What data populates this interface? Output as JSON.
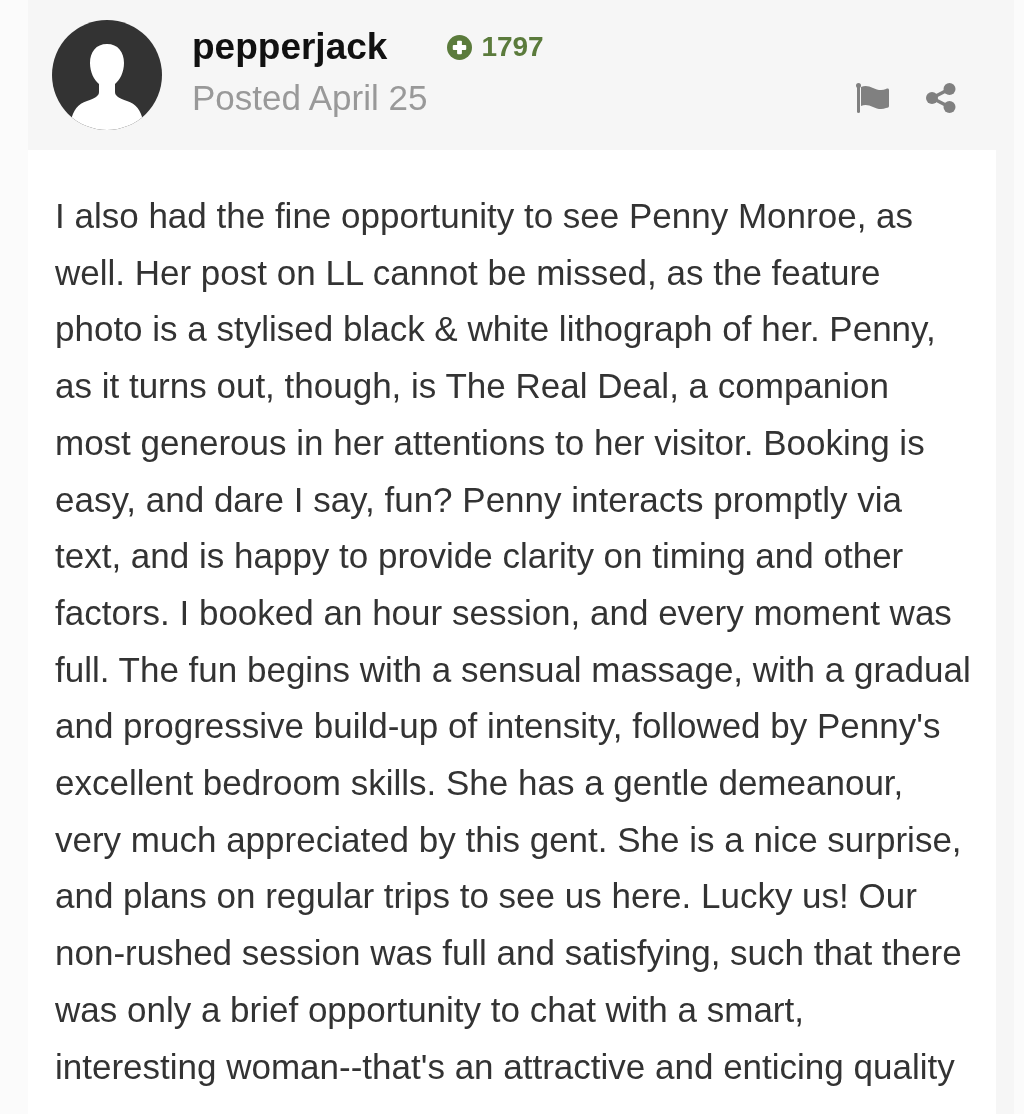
{
  "post": {
    "author": {
      "name": "pepperjack",
      "reputation": "1797"
    },
    "date": "Posted April 25",
    "body": "I also had the fine opportunity to see Penny Monroe, as well. Her post on LL cannot be missed, as the feature photo is a stylised black & white lithograph of her. Penny, as it turns out, though, is The Real Deal, a companion most generous in her attentions to her visitor. Booking is easy, and dare I say, fun? Penny interacts promptly via text, and is happy to provide clarity on timing and other factors. I booked an hour session, and every moment was full. The fun begins with a sensual massage, with a gradual and progressive build-up of intensity, followed by Penny's excellent bedroom skills. She has a gentle demeanour, very much appreciated by this gent. She is a nice surprise, and plans on regular trips to see us here. Lucky us! Our non-rushed session was full and satisfying, such that there was only a brief opportunity to chat with a smart, interesting woman--that's an attractive and enticing quality"
  }
}
